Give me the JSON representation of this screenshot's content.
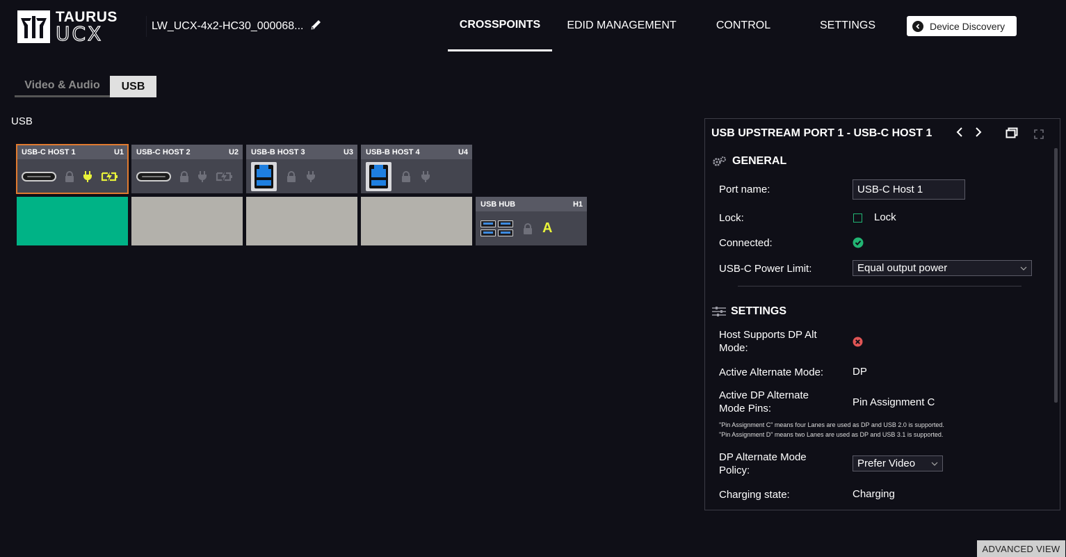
{
  "logo": {
    "line1": "TAURUS",
    "line2": "UCX"
  },
  "device": {
    "name": "LW_UCX-4x2-HC30_000068..."
  },
  "nav": {
    "items": [
      {
        "label": "CROSSPOINTS",
        "active": true
      },
      {
        "label": "EDID MANAGEMENT",
        "active": false
      },
      {
        "label": "CONTROL",
        "active": false
      },
      {
        "label": "SETTINGS",
        "active": false
      }
    ],
    "discovery_label": "Device Discovery"
  },
  "subtabs": [
    {
      "label": "Video & Audio",
      "active": false
    },
    {
      "label": "USB",
      "active": true
    }
  ],
  "section_label": "USB",
  "hosts": [
    {
      "name": "USB-C HOST 1",
      "id": "U1",
      "connector": "usb-c"
    },
    {
      "name": "USB-C HOST 2",
      "id": "U2",
      "connector": "usb-c"
    },
    {
      "name": "USB-B HOST 3",
      "id": "U3",
      "connector": "usb-b"
    },
    {
      "name": "USB-B HOST 4",
      "id": "U4",
      "connector": "usb-b"
    }
  ],
  "hub": {
    "name": "USB HUB",
    "id": "H1",
    "letter": "A"
  },
  "colors": {
    "connected": "#00b386",
    "idle": "#b3b1ab",
    "accent_yellow": "#e8f23a",
    "selected_border": "#e07a2f"
  },
  "panel": {
    "title": "USB UPSTREAM PORT 1 - USB-C HOST 1",
    "general_heading": "GENERAL",
    "port_name_label": "Port name:",
    "port_name_value": "USB-C Host 1",
    "lock_label": "Lock:",
    "lock_checkbox_label": "Lock",
    "connected_label": "Connected:",
    "power_limit_label": "USB-C Power Limit:",
    "power_limit_value": "Equal output power",
    "settings_heading": "SETTINGS",
    "dp_alt_label": "Host Supports DP Alt Mode:",
    "active_alt_label": "Active Alternate Mode:",
    "active_alt_value": "DP",
    "active_pins_label": "Active DP Alternate Mode Pins:",
    "active_pins_value": "Pin Assignment C",
    "note1": "\"Pin Assignment C\" means four Lanes are used as DP and USB 2.0 is supported.",
    "note2": "\"Pin Assignment D\" means two Lanes are used as DP and USB 3.1 is supported.",
    "policy_label": "DP Alternate Mode Policy:",
    "policy_value": "Prefer Video",
    "charging_label": "Charging state:",
    "charging_value": "Charging"
  },
  "advanced_view_label": "ADVANCED VIEW"
}
